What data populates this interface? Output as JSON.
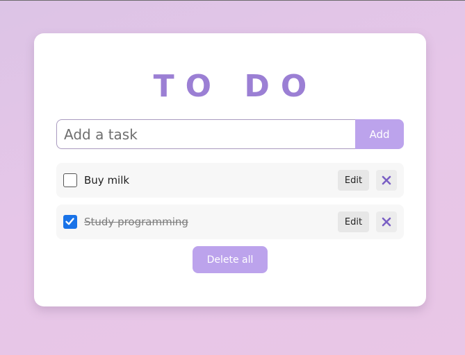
{
  "app": {
    "title": "TO DO"
  },
  "input": {
    "placeholder": "Add a task",
    "value": "",
    "add_label": "Add"
  },
  "todos": [
    {
      "text": "Buy milk",
      "completed": false,
      "edit_label": "Edit",
      "delete_icon": "close-icon"
    },
    {
      "text": "Study programming",
      "completed": true,
      "edit_label": "Edit",
      "delete_icon": "close-icon"
    }
  ],
  "footer": {
    "delete_all_label": "Delete all"
  },
  "colors": {
    "accent": "#9b7fd4",
    "button": "#bca3ec",
    "checkbox_checked": "#1a73e8",
    "delete_x": "#7a5fc4"
  }
}
